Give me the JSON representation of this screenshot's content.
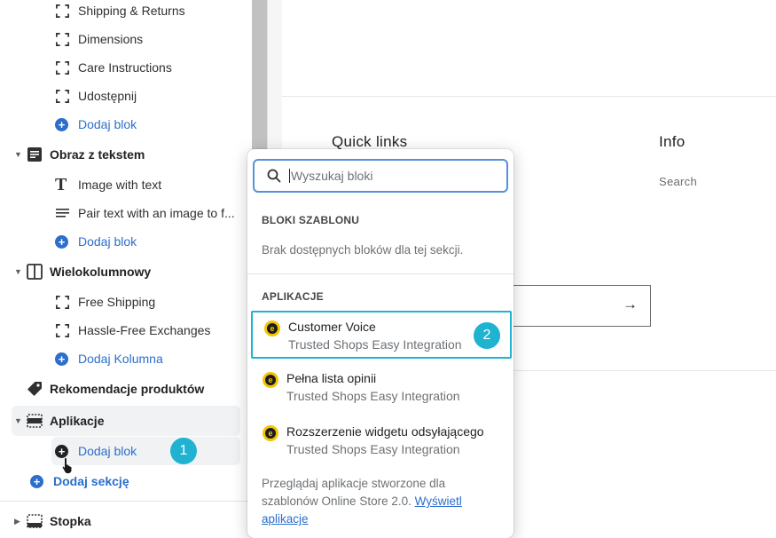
{
  "sidebar": {
    "shipping_returns": "Shipping & Returns",
    "dimensions": "Dimensions",
    "care_instructions": "Care Instructions",
    "share": "Udostępnij",
    "add_block_1": "Dodaj blok",
    "image_with_text_section": "Obraz z tekstem",
    "image_with_text": "Image with text",
    "pair_text": "Pair text with an image to f...",
    "add_block_2": "Dodaj blok",
    "multicolumn_section": "Wielokolumnowy",
    "free_shipping": "Free Shipping",
    "hassle_free": "Hassle-Free Exchanges",
    "add_column": "Dodaj Kolumna",
    "product_recommendations": "Rekomendacje produktów",
    "apps_section": "Aplikacje",
    "add_block_3": "Dodaj blok",
    "add_section": "Dodaj sekcję",
    "footer_section": "Stopka"
  },
  "badges": {
    "one": "1",
    "two": "2"
  },
  "preview": {
    "quick_links": "Quick links",
    "info": "Info",
    "search_link": "Search",
    "arrow": "→"
  },
  "popover": {
    "search_placeholder": "Wyszukaj bloki",
    "template_blocks_heading": "BLOKI SZABLONU",
    "no_blocks_text": "Brak dostępnych bloków dla tej sekcji.",
    "apps_heading": "APLIKACJE",
    "apps": [
      {
        "title": "Customer Voice",
        "subtitle": "Trusted Shops Easy Integration"
      },
      {
        "title": "Pełna lista opinii",
        "subtitle": "Trusted Shops Easy Integration"
      },
      {
        "title": "Rozszerzenie widgetu odsyłającego",
        "subtitle": "Trusted Shops Easy Integration"
      }
    ],
    "browse_text": "Przeglądaj aplikacje stworzone dla szablonów Online Store 2.0.",
    "browse_link": "Wyświetl aplikacje"
  }
}
